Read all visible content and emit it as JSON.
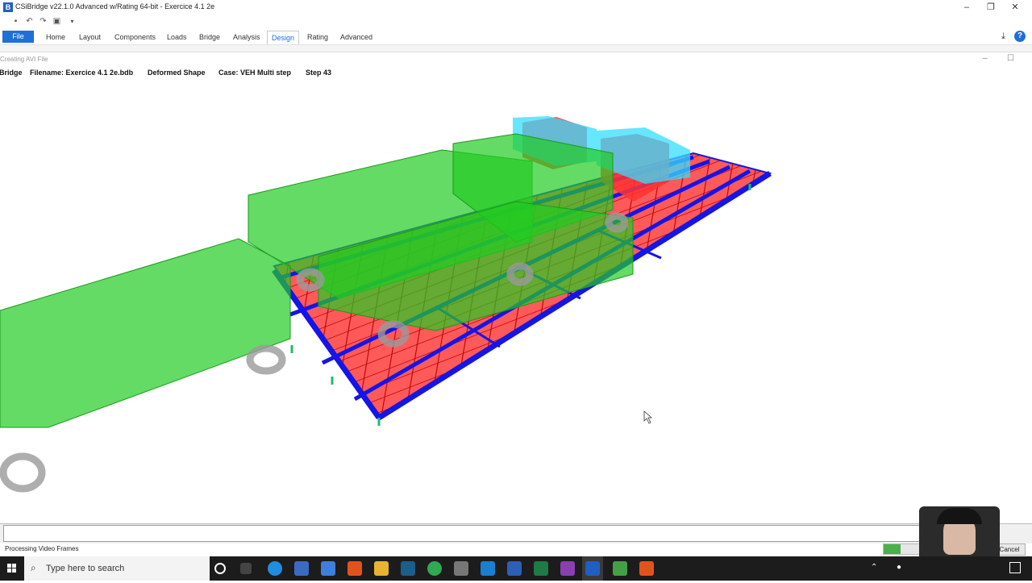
{
  "window": {
    "app_icon": "B",
    "title": "CSiBridge v22.1.0 Advanced w/Rating 64-bit - Exercice 4.1 2e",
    "minimize": "–",
    "restore": "❐",
    "close": "✕"
  },
  "ribbon": {
    "tabs": [
      "File",
      "Home",
      "Layout",
      "Components",
      "Loads",
      "Bridge",
      "Analysis",
      "Design",
      "Rating",
      "Advanced"
    ],
    "active_tab": "Design"
  },
  "subwindow": {
    "title": "Creating AVI File",
    "info": {
      "program": "Bridge",
      "filename": "Filename: Exercice 4.1 2e.bdb",
      "view": "Deformed Shape",
      "case": "Case: VEH Multi step",
      "step": "Step 43"
    }
  },
  "status": {
    "text": "Processing Video Frames",
    "progress_percent": 30,
    "cancel_label": "Cancel"
  },
  "taskbar": {
    "search_placeholder": "Type here to search",
    "icons": [
      "cortana-icon",
      "task-view-icon",
      "edge-icon",
      "store-icon",
      "mail-icon",
      "office-icon",
      "file-explorer-icon",
      "steam-icon",
      "chrome-icon",
      "settings-icon",
      "app-blue-icon",
      "word-icon",
      "excel-icon",
      "app-purple-icon",
      "csibridge-icon",
      "camtasia-icon",
      "app-orange-icon"
    ]
  },
  "colors": {
    "accent": "#1e6fd6",
    "deck_red": "#ff4d4d",
    "girder_blue": "#1515e6",
    "truck_green": "#22cc22",
    "truck_cyan": "#33ddff"
  }
}
